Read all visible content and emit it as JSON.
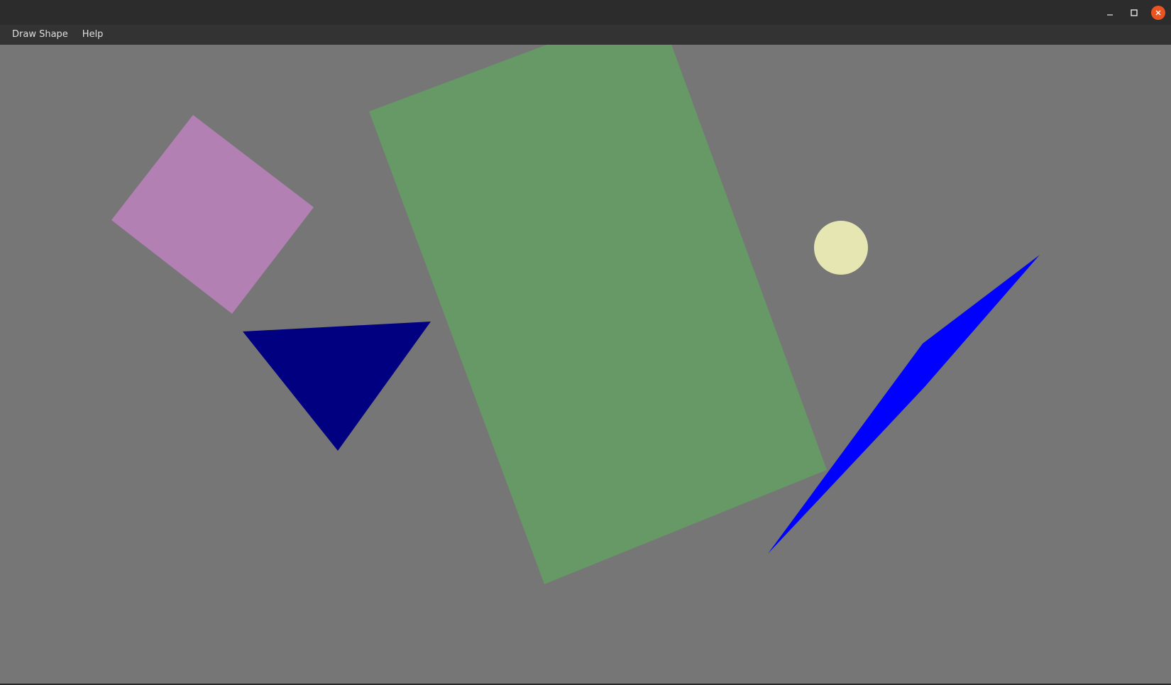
{
  "window": {
    "controls": [
      "minimize-icon",
      "maximize-icon",
      "close-icon"
    ],
    "close_color": "#e95420"
  },
  "menubar": {
    "items": [
      {
        "label": "Draw Shape"
      },
      {
        "label": "Help"
      }
    ]
  },
  "canvas": {
    "background": "#767676",
    "shapes": [
      {
        "kind": "rectangle",
        "fill": "#669966"
      },
      {
        "kind": "square",
        "fill": "#b380b3"
      },
      {
        "kind": "triangle",
        "fill": "#000080"
      },
      {
        "kind": "circle",
        "fill": "#e6e6b3"
      },
      {
        "kind": "thin-quadrilateral",
        "fill": "#0000ff"
      }
    ]
  }
}
